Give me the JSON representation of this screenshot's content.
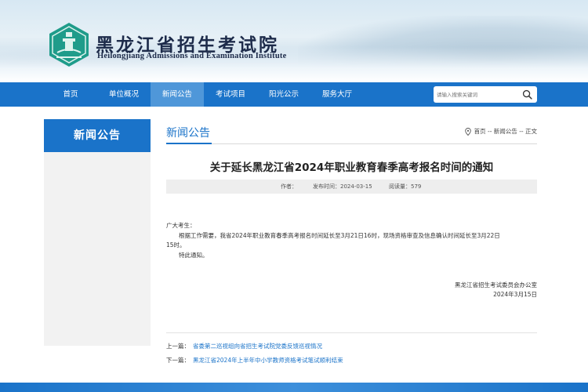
{
  "header": {
    "title": "黑龙江省招生考试院",
    "subtitle": "Heilongjiang Admissions and Examination Institute"
  },
  "nav": {
    "items": [
      {
        "label": "首页"
      },
      {
        "label": "单位概况"
      },
      {
        "label": "新闻公告",
        "active": true
      },
      {
        "label": "考试项目"
      },
      {
        "label": "阳光公示"
      },
      {
        "label": "服务大厅"
      }
    ],
    "search_placeholder": "请输入搜索关键词"
  },
  "sidebar": {
    "title": "新闻公告"
  },
  "section": {
    "title": "新闻公告",
    "breadcrumb": "首页 -- 新闻公告 -- 正文"
  },
  "article": {
    "title": "关于延长黑龙江省2024年职业教育春季高考报名时间的通知",
    "meta": {
      "author": "作者：",
      "date": "发布时间：2024-03-15",
      "views": "阅读量：579"
    },
    "greeting": "广大考生：",
    "para1_line1": "根据工作需要，我省2024年职业教育春季高考报名时间延长至3月21日16时，现场资格审查及信息确认时间延长至3月22日",
    "para1_line2": "15时。",
    "para2": "特此通知。",
    "signature_org": "黑龙江省招生考试委员会办公室",
    "signature_date": "2024年3月15日"
  },
  "pager": {
    "prev_label": "上一篇：",
    "prev_title": "省委第二巡视组向省招生考试院党委反馈巡视情况",
    "next_label": "下一篇：",
    "next_title": "黑龙江省2024年上半年中小学教师资格考试笔试顺利结束"
  },
  "colors": {
    "primary": "#1a73c9",
    "nav_active": "#4f97d9"
  }
}
